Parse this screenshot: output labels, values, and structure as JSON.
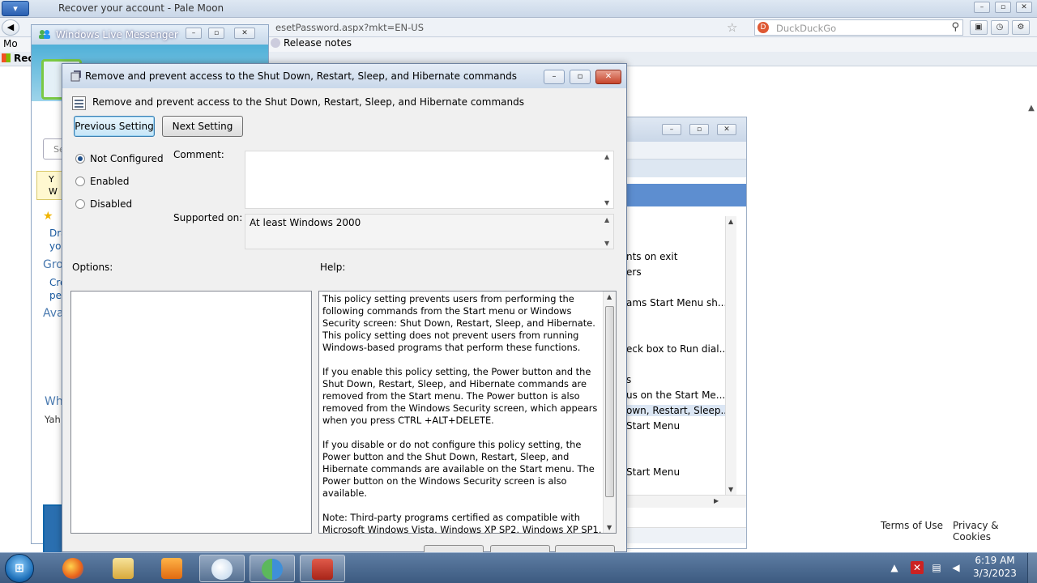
{
  "browser": {
    "menu_label": "▾",
    "title": "Recover your account - Pale Moon",
    "url": "esetPassword.aspx?mkt=EN-US",
    "search_placeholder": "DuckDuckGo",
    "bookmarks": {
      "most_visited": "Mo",
      "release_notes": "Release notes"
    },
    "tab_label": "Rec",
    "footer": {
      "terms": "Terms of Use",
      "privacy": "Privacy & Cookies"
    }
  },
  "messenger": {
    "title": "Windows Live Messenger",
    "search_fragment": "Se",
    "notice_fragment": "Y\nW",
    "fragments": {
      "dra": "Dra",
      "you": "you",
      "groups": "Gro",
      "cre": "Cre",
      "pe": "pe",
      "avail": "Ava",
      "wh": "Wh",
      "yah": "Yah"
    }
  },
  "gpe": {
    "items": [
      "nts on exit",
      "ers",
      "ams Start Menu sh...",
      "eck box to Run dial...",
      "s",
      "us on the Start Me...",
      "own, Restart, Sleep...",
      "Start Menu",
      "Start Menu"
    ]
  },
  "dialog": {
    "title": "Remove and prevent access to the Shut Down, Restart, Sleep, and Hibernate commands",
    "setting_header": "Remove and prevent access to the Shut Down, Restart, Sleep, and Hibernate commands",
    "previous_button": "Previous Setting",
    "next_button": "Next Setting",
    "radios": {
      "not_configured": "Not Configured",
      "enabled": "Enabled",
      "disabled": "Disabled",
      "selected": "not_configured"
    },
    "comment_label": "Comment:",
    "comment_value": "",
    "supported_label": "Supported on:",
    "supported_value": "At least Windows 2000",
    "options_label": "Options:",
    "help_label": "Help:",
    "help_text": "This policy setting prevents users from performing the following commands from the Start menu or Windows Security screen: Shut Down, Restart, Sleep, and Hibernate. This policy setting does not prevent users from running Windows-based programs that perform these functions.\n\nIf you enable this policy setting, the Power button and the Shut Down, Restart, Sleep, and Hibernate commands are removed from the Start menu. The Power button is also removed from the Windows Security screen, which appears when you press CTRL +ALT+DELETE.\n\nIf you disable or do not configure this policy setting, the Power button and the Shut Down, Restart, Sleep, and Hibernate commands are available on the Start menu. The Power button on the Windows Security screen is also available.\n\nNote: Third-party programs certified as compatible with Microsoft Windows Vista, Windows XP SP2, Windows XP SP1,"
  },
  "taskbar": {
    "start_label": "⊞",
    "clock_time": "6:19 AM",
    "clock_date": "3/3/2023"
  },
  "colors": {
    "accent": "#3c7fb1",
    "taskbar": "#3c5a80",
    "close_button": "#c6452c"
  }
}
